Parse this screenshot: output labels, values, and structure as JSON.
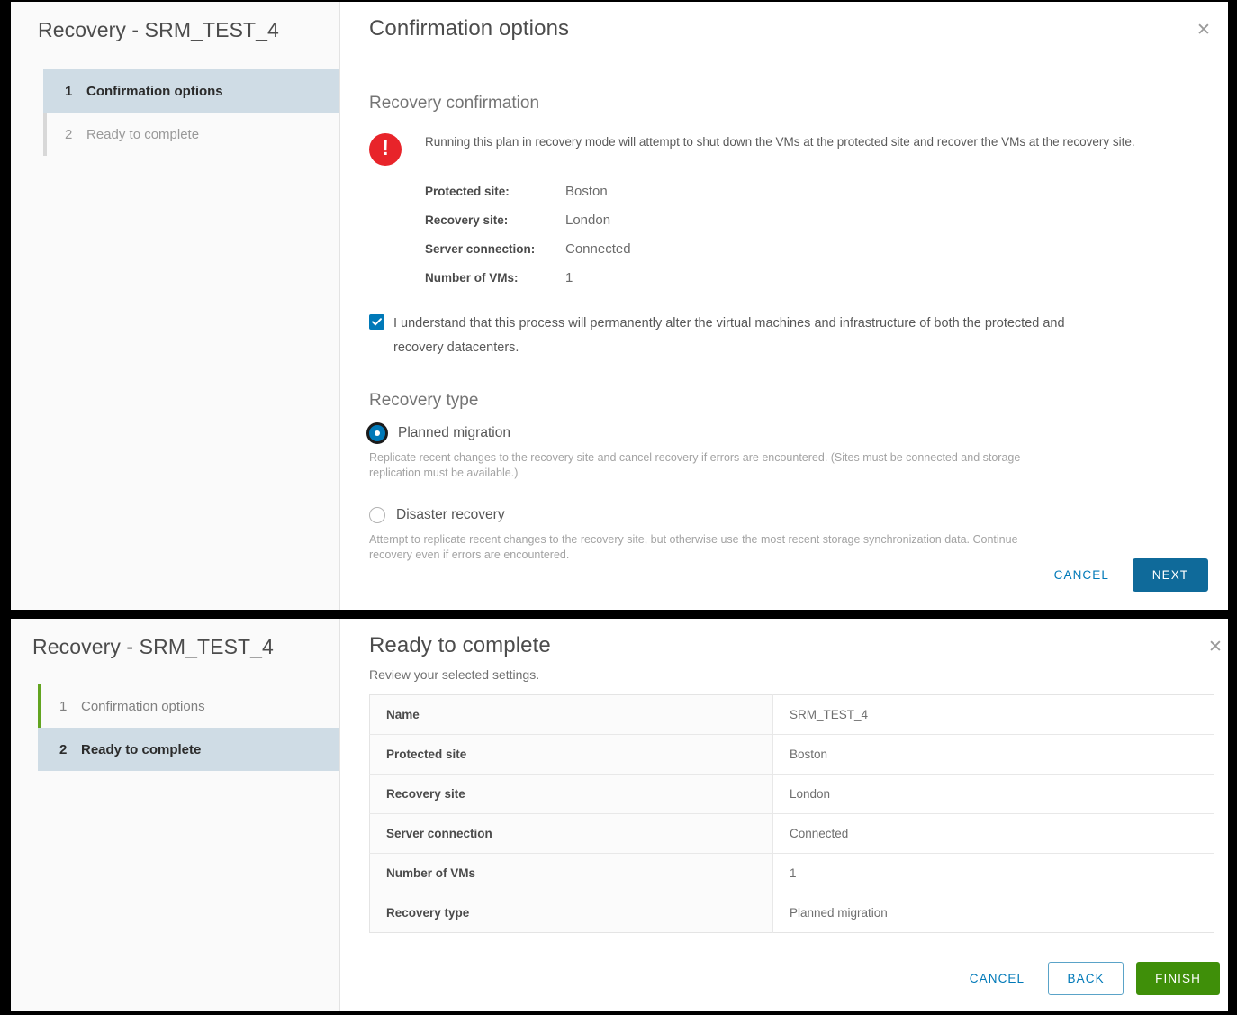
{
  "dialog_one": {
    "wizard_title": "Recovery - SRM_TEST_4",
    "steps": [
      {
        "num": "1",
        "label": "Confirmation options"
      },
      {
        "num": "2",
        "label": "Ready to complete"
      }
    ],
    "pane_title": "Confirmation options",
    "close_glyph": "✕",
    "section_heading": "Recovery confirmation",
    "warning_text": "Running this plan in recovery mode will attempt to shut down the VMs at the protected site and recover the VMs at the recovery site.",
    "details": [
      {
        "key": "Protected site:",
        "value": "Boston"
      },
      {
        "key": "Recovery site:",
        "value": "London"
      },
      {
        "key": "Server connection:",
        "value": "Connected"
      },
      {
        "key": "Number of VMs:",
        "value": "1"
      }
    ],
    "acknowledgement": "I understand that this process will permanently alter the virtual machines and infrastructure of both the protected and recovery datacenters.",
    "recovery_type_heading": "Recovery type",
    "options": [
      {
        "label": "Planned migration",
        "description": "Replicate recent changes to the recovery site and cancel recovery if errors are encountered. (Sites must be connected and storage replication must be available.)"
      },
      {
        "label": "Disaster recovery",
        "description": "Attempt to replicate recent changes to the recovery site, but otherwise use the most recent storage synchronization data. Continue recovery even if errors are encountered."
      }
    ],
    "buttons": {
      "cancel": "CANCEL",
      "next": "NEXT"
    }
  },
  "dialog_two": {
    "wizard_title": "Recovery - SRM_TEST_4",
    "steps": [
      {
        "num": "1",
        "label": "Confirmation options"
      },
      {
        "num": "2",
        "label": "Ready to complete"
      }
    ],
    "pane_title": "Ready to complete",
    "pane_subtitle": "Review your selected settings.",
    "close_glyph": "✕",
    "summary_rows": [
      {
        "key": "Name",
        "value": "SRM_TEST_4"
      },
      {
        "key": "Protected site",
        "value": "Boston"
      },
      {
        "key": "Recovery site",
        "value": "London"
      },
      {
        "key": "Server connection",
        "value": "Connected"
      },
      {
        "key": "Number of VMs",
        "value": "1"
      },
      {
        "key": "Recovery type",
        "value": "Planned migration"
      }
    ],
    "buttons": {
      "cancel": "CANCEL",
      "back": "BACK",
      "finish": "FINISH"
    }
  },
  "colors": {
    "accent_blue": "#0079b8",
    "primary_button": "#0f6a9a",
    "success_green": "#3f8f09",
    "step_complete_green": "#62a420",
    "warning_red": "#e8242a",
    "active_step_bg": "#cfdce5"
  }
}
